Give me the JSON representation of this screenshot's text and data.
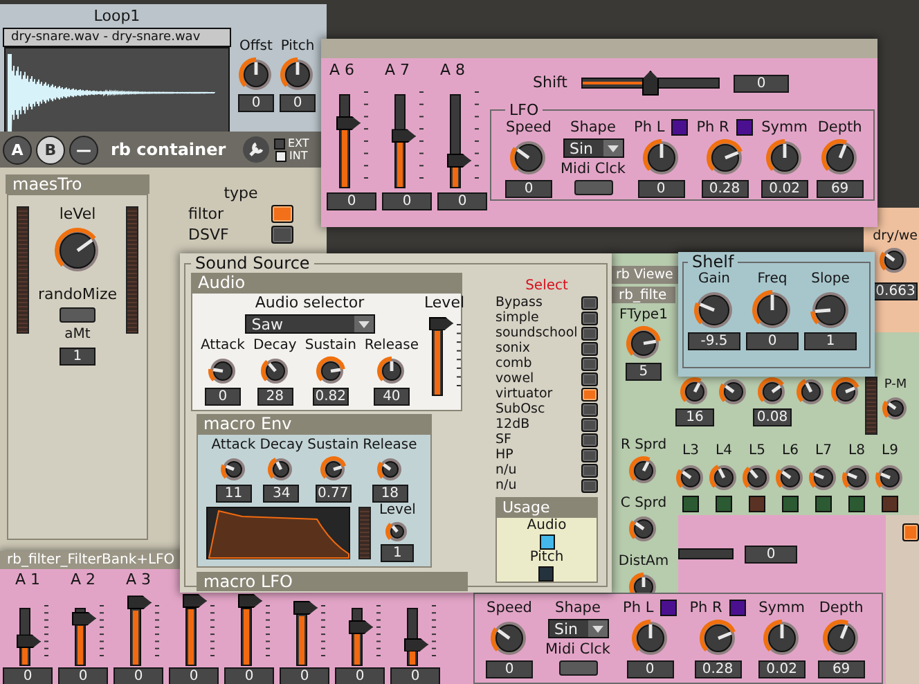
{
  "loop": {
    "title": "Loop1",
    "sample_name": "dry-snare.wav - dry-snare.wav",
    "knobs": [
      {
        "label": "Offst",
        "level": 0.5,
        "value": "0"
      },
      {
        "label": "Pitch",
        "level": 0.5,
        "value": "0"
      }
    ]
  },
  "container": {
    "buttons": [
      {
        "label": "A",
        "selected": false
      },
      {
        "label": "B",
        "selected": true
      },
      {
        "label": "—",
        "selected": false
      }
    ],
    "title": "rb container",
    "sync": [
      {
        "label": "EXT",
        "selected": false
      },
      {
        "label": "INT",
        "selected": true
      }
    ]
  },
  "maestro": {
    "title": "maesTro",
    "knob": {
      "label": "leVel",
      "level": 0.7
    },
    "button": "randoMize",
    "amount_label": "aMt",
    "amount_value": "1"
  },
  "type": {
    "title": "type",
    "options": [
      {
        "label": "filtor",
        "selected": true
      },
      {
        "label": "DSVF",
        "selected": false
      }
    ]
  },
  "top_panel": {
    "sliders": [
      {
        "label": "A 6",
        "level": 0.62,
        "value": "0"
      },
      {
        "label": "A 7",
        "level": 0.48,
        "value": "0"
      },
      {
        "label": "A 8",
        "level": 0.22,
        "value": "0"
      }
    ],
    "shift": {
      "label": "Shift",
      "level": 0.5,
      "value": "0"
    },
    "lfo": {
      "title": "LFO",
      "controls": [
        {
          "kind": "knob",
          "label": "Speed",
          "level": 0.3,
          "value": "0"
        },
        {
          "kind": "select",
          "label": "Shape",
          "value": "Sin",
          "button": "Midi Clck"
        },
        {
          "kind": "knob",
          "label": "Ph L",
          "level": 0.5,
          "value": "0",
          "checked": true
        },
        {
          "kind": "knob",
          "label": "Ph R",
          "level": 0.75,
          "value": "0.28",
          "checked": true
        },
        {
          "kind": "knob",
          "label": "Symm",
          "level": 0.5,
          "value": "0.02"
        },
        {
          "kind": "knob",
          "label": "Depth",
          "level": 0.58,
          "value": "69"
        }
      ]
    }
  },
  "bottom_left": {
    "title": "rb_filter_FilterBank+LFO",
    "sliders": [
      {
        "label": "A 1",
        "level": 0.3,
        "value": "0"
      },
      {
        "label": "A 2",
        "level": 0.7,
        "value": "0"
      },
      {
        "label": "A 3",
        "level": 0.97,
        "value": "0"
      },
      {
        "level": 1,
        "value": "0"
      },
      {
        "level": 1,
        "value": "0"
      },
      {
        "level": 0.88,
        "value": "0"
      },
      {
        "level": 0.55,
        "value": "0"
      },
      {
        "level": 0.25,
        "value": "0"
      }
    ]
  },
  "bottom_right": {
    "shift_value": "0",
    "controls": [
      {
        "kind": "knob",
        "label": "Speed",
        "level": 0.3,
        "value": "0"
      },
      {
        "kind": "select",
        "label": "Shape",
        "value": "Sin",
        "button": "Midi Clck"
      },
      {
        "kind": "knob",
        "label": "Ph L",
        "level": 0.5,
        "value": "0",
        "checked": true
      },
      {
        "kind": "knob",
        "label": "Ph R",
        "level": 0.75,
        "value": "0.28",
        "checked": true
      },
      {
        "kind": "knob",
        "label": "Symm",
        "level": 0.5,
        "value": "0.02"
      },
      {
        "kind": "knob",
        "label": "Depth",
        "level": 0.58,
        "value": "69"
      }
    ],
    "edge_button": {
      "on": true
    }
  },
  "sound_source": {
    "title": "Sound Source",
    "audio": {
      "title": "Audio",
      "selector_label": "Audio selector",
      "selector_value": "Saw",
      "knobs": [
        {
          "label": "Attack",
          "level": 0.2,
          "value": "0"
        },
        {
          "label": "Decay",
          "level": 0.35,
          "value": "28"
        },
        {
          "label": "Sustain",
          "level": 0.8,
          "value": "0.82"
        },
        {
          "label": "Release",
          "level": 0.5,
          "value": "40"
        }
      ],
      "level_label": "Level",
      "level": 0.95
    },
    "macro_env": {
      "title": "macro Env",
      "knobs": [
        {
          "label": "Attack",
          "level": 0.25,
          "value": "11"
        },
        {
          "label": "Decay",
          "level": 0.4,
          "value": "34"
        },
        {
          "label": "Sustain",
          "level": 0.77,
          "value": "0.77"
        },
        {
          "label": "Release",
          "level": 0.3,
          "value": "18"
        }
      ],
      "level_control": {
        "label": "Level",
        "level": 0.35,
        "value": "1"
      }
    },
    "macro_lfo": {
      "title": "macro LFO"
    },
    "select": {
      "title": "Select",
      "items": [
        {
          "label": "Bypass",
          "selected": false
        },
        {
          "label": "simple",
          "selected": false
        },
        {
          "label": "soundschool",
          "selected": false
        },
        {
          "label": "sonix",
          "selected": false
        },
        {
          "label": "comb",
          "selected": false
        },
        {
          "label": "vowel",
          "selected": false
        },
        {
          "label": "virtuator",
          "selected": true
        },
        {
          "label": "SubOsc",
          "selected": false
        },
        {
          "label": "12dB",
          "selected": false
        },
        {
          "label": "SF",
          "selected": false
        },
        {
          "label": "HP",
          "selected": false
        },
        {
          "label": "n/u",
          "selected": false
        },
        {
          "label": "n/u",
          "selected": false
        }
      ]
    },
    "usage": {
      "title": "Usage",
      "items": [
        {
          "label": "Audio",
          "on": true
        },
        {
          "label": "Pitch",
          "on": false
        }
      ]
    }
  },
  "viewer": {
    "title": "rb Viewe",
    "inner_title": "rb_filte",
    "ftype": {
      "label": "FType1",
      "level": 0.8,
      "value": "5"
    },
    "row_knobs": [
      {
        "level": 0.6,
        "value": "16"
      },
      {
        "level": 0.3
      },
      {
        "level": 0.7,
        "value": "0.08"
      },
      {
        "level": 0.4
      },
      {
        "level": 0.75
      }
    ],
    "pm": {
      "label": "P-M",
      "level": 0.3
    },
    "spread": [
      {
        "label": "R Sprd",
        "level": 0.6
      },
      {
        "label": "C Sprd",
        "level": 0.3
      },
      {
        "label": "DistAm",
        "level": 0.5
      }
    ],
    "bands": [
      {
        "label": "L3",
        "level": 0.3,
        "on": true
      },
      {
        "label": "L4",
        "level": 0.4,
        "on": true
      },
      {
        "label": "L5",
        "level": 0.35,
        "on": false
      },
      {
        "label": "L6",
        "level": 0.3,
        "on": true
      },
      {
        "label": "L7",
        "level": 0.25,
        "on": true
      },
      {
        "label": "L8",
        "level": 0.25,
        "on": true
      },
      {
        "label": "L9",
        "level": 0.25,
        "on": false
      }
    ]
  },
  "shelf": {
    "title": "Shelf",
    "knobs": [
      {
        "label": "Gain",
        "level": 0.25,
        "value": "-9.5"
      },
      {
        "label": "Freq",
        "level": 0.5,
        "value": "0"
      },
      {
        "label": "Slope",
        "level": 0.15,
        "value": "1"
      }
    ]
  },
  "dry": {
    "label": "dry/we",
    "level": 0.3,
    "value": "0.663"
  }
}
